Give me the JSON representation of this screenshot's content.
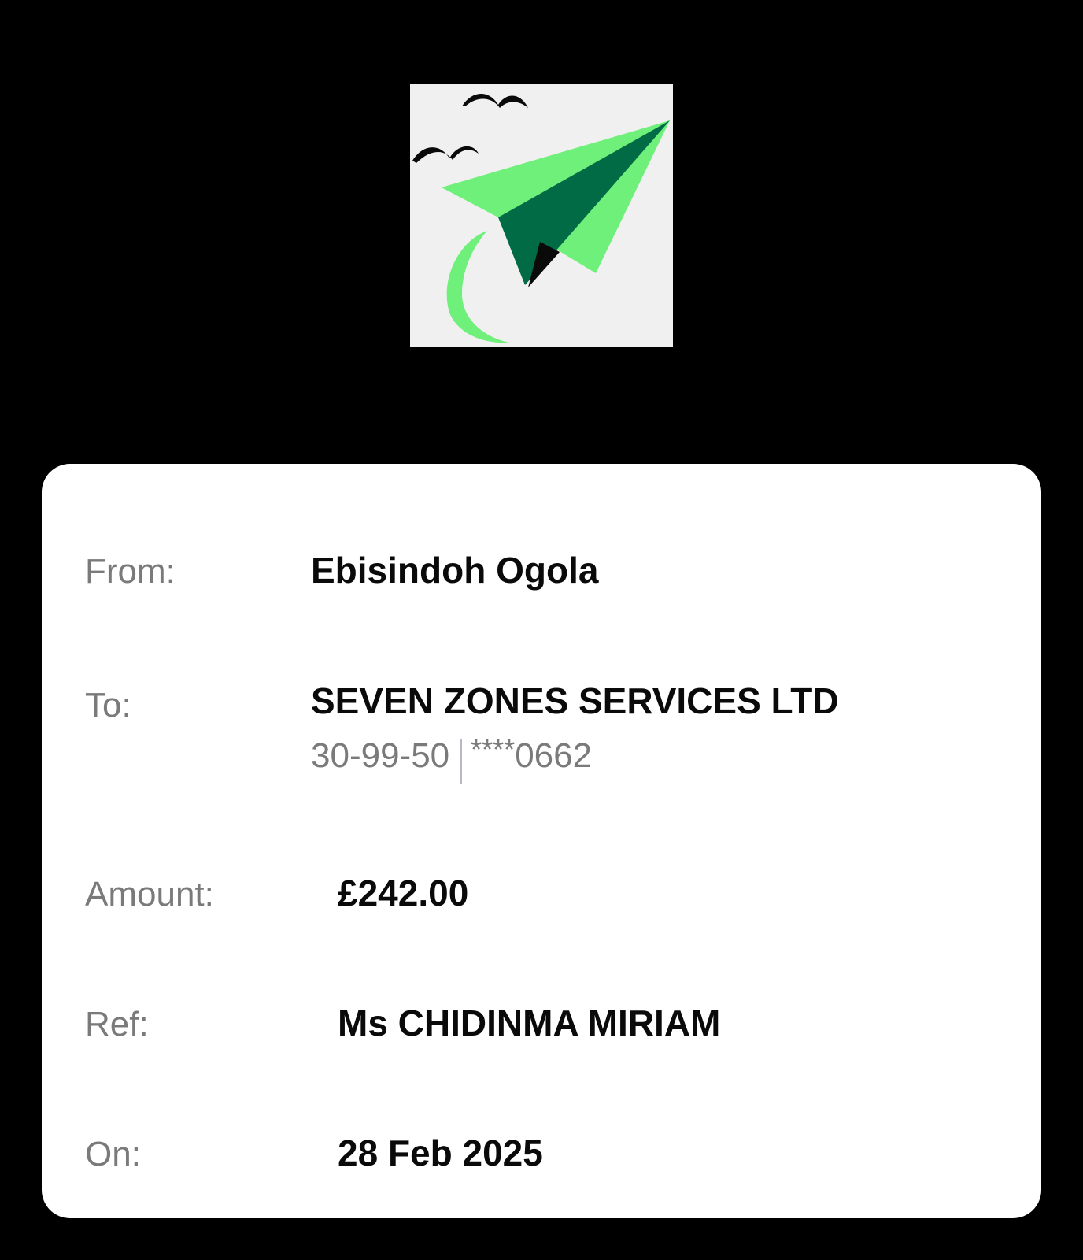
{
  "logo": {
    "icon": "paper-plane-with-birds-logo",
    "colors": {
      "background": "#f0f0f0",
      "wing_light": "#6ef07a",
      "wing_dark": "#006b45",
      "tail": "#0a0a0a",
      "birds": "#0a0a0a"
    }
  },
  "transfer": {
    "from": {
      "label": "From:",
      "value": "Ebisindoh Ogola"
    },
    "to": {
      "label": "To:",
      "name": "SEVEN ZONES SERVICES LTD",
      "sort_code": "30-99-50",
      "account_mask": "****",
      "account_last4": "0662"
    },
    "amount": {
      "label": "Amount:",
      "value": "£242.00"
    },
    "ref": {
      "label": "Ref:",
      "value": "Ms CHIDINMA MIRIAM"
    },
    "on": {
      "label": "On:",
      "value": "28 Feb 2025"
    }
  }
}
